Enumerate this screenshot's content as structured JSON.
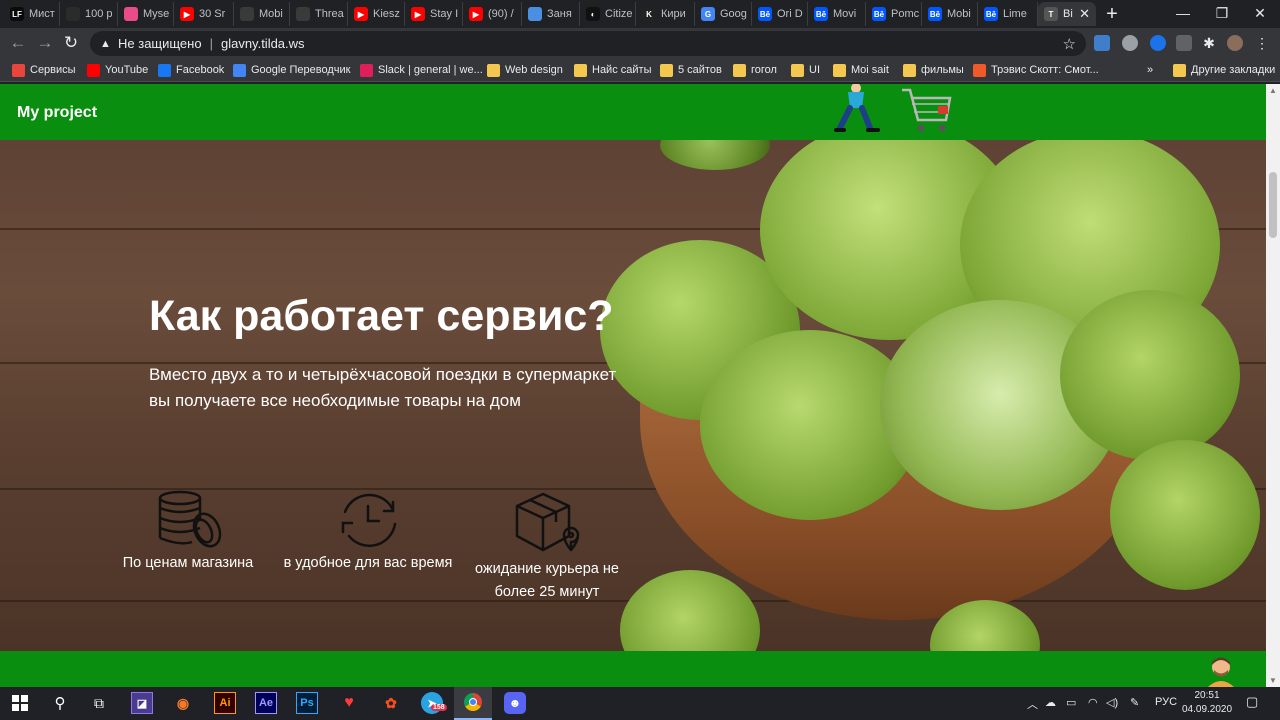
{
  "tabs": [
    {
      "label": "Мист",
      "icon": "lf-icon",
      "color": "#0b0b0b",
      "glyph": "LF"
    },
    {
      "label": "100 р",
      "icon": "page-icon",
      "color": "#2b2b2b",
      "glyph": ""
    },
    {
      "label": "Myse",
      "icon": "dribbble-icon",
      "color": "#ea4c89",
      "glyph": ""
    },
    {
      "label": "30 Sr",
      "icon": "youtube-icon",
      "color": "#ff0000",
      "glyph": "▶"
    },
    {
      "label": "Mobi",
      "icon": "page-icon",
      "color": "#3a3a3a",
      "glyph": ""
    },
    {
      "label": "Threa",
      "icon": "page-icon",
      "color": "#3a3a3a",
      "glyph": ""
    },
    {
      "label": "Kiesz",
      "icon": "youtube-icon",
      "color": "#ff0000",
      "glyph": "▶"
    },
    {
      "label": "Stay I",
      "icon": "youtube-icon",
      "color": "#ff0000",
      "glyph": "▶"
    },
    {
      "label": "(90) /",
      "icon": "youtube-icon",
      "color": "#ff0000",
      "glyph": "▶"
    },
    {
      "label": "Заня",
      "icon": "cloud-icon",
      "color": "#4a90e2",
      "glyph": ""
    },
    {
      "label": "Citize",
      "icon": "page-icon",
      "color": "#111111",
      "glyph": "◐"
    },
    {
      "label": "Кири",
      "icon": "page-icon",
      "color": "#222222",
      "glyph": "K"
    },
    {
      "label": "Goog",
      "icon": "google-icon",
      "color": "#4285f4",
      "glyph": "G"
    },
    {
      "label": "Ori D",
      "icon": "behance-icon",
      "color": "#0057ff",
      "glyph": "Bē"
    },
    {
      "label": "Movi",
      "icon": "behance-icon",
      "color": "#0057ff",
      "glyph": "Bē"
    },
    {
      "label": "Pomc",
      "icon": "behance-icon",
      "color": "#0057ff",
      "glyph": "Bē"
    },
    {
      "label": "Mobi",
      "icon": "behance-icon",
      "color": "#0057ff",
      "glyph": "Bē"
    },
    {
      "label": "Lime",
      "icon": "behance-icon",
      "color": "#0057ff",
      "glyph": "Bē"
    },
    {
      "label": "Bi",
      "icon": "tilda-icon",
      "color": "#555555",
      "glyph": "T",
      "active": true
    }
  ],
  "omnibox": {
    "security": "Не защищено",
    "url": "glavny.tilda.ws"
  },
  "bookmarks": [
    {
      "label": "Сервисы",
      "icon": "apps-icon",
      "color": "#e8453c"
    },
    {
      "label": "YouTube",
      "icon": "youtube-icon",
      "color": "#ff0000"
    },
    {
      "label": "Facebook",
      "icon": "facebook-icon",
      "color": "#1877f2"
    },
    {
      "label": "Google Переводчик",
      "icon": "translate-icon",
      "color": "#4285f4"
    },
    {
      "label": "Slack | general | we...",
      "icon": "slack-icon",
      "color": "#e01e5a"
    },
    {
      "label": "Web design",
      "icon": "folder-icon",
      "color": "#f4c74e"
    },
    {
      "label": "Найс сайты",
      "icon": "folder-icon",
      "color": "#f4c74e"
    },
    {
      "label": "5 сайтов",
      "icon": "folder-icon",
      "color": "#f4c74e"
    },
    {
      "label": "гогол",
      "icon": "folder-icon",
      "color": "#f4c74e"
    },
    {
      "label": "UI",
      "icon": "folder-icon",
      "color": "#f4c74e"
    },
    {
      "label": "Moi sait",
      "icon": "folder-icon",
      "color": "#f4c74e"
    },
    {
      "label": "фильмы",
      "icon": "folder-icon",
      "color": "#f4c74e"
    },
    {
      "label": "Трэвис Скотт: Смот...",
      "icon": "app-icon",
      "color": "#f05a28"
    }
  ],
  "bookmarks_more": "»",
  "bookmarks_other": "Другие закладки",
  "site": {
    "brand": "My project",
    "accent": "#0a8e10",
    "hero_title": "Как работает сервис?",
    "hero_subtitle": "Вместо двух а то и четырёхчасовой поездки в супермаркет вы получаете все необходимые товары на дом",
    "features": [
      {
        "text": "По ценам магазина",
        "icon": "coins-icon"
      },
      {
        "text": "в удобное для вас время",
        "icon": "clock-icon"
      },
      {
        "text": "ожидание курьера не более 25 минут",
        "icon": "delivery-box-icon"
      }
    ]
  },
  "taskbar": {
    "telegram_badge": "158",
    "language": "РУС",
    "time": "20:51",
    "date": "04.09.2020"
  }
}
